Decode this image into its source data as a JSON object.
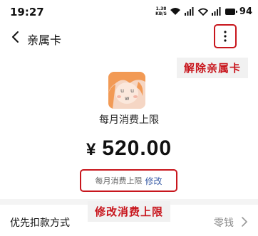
{
  "status_bar": {
    "time": "19:27",
    "net_speed_value": "1.38",
    "net_speed_unit": "KB/S",
    "battery": "94"
  },
  "nav": {
    "title": "亲属卡"
  },
  "annotations": {
    "unbind_label": "解除亲属卡",
    "modify_label": "修改消费上限",
    "highlight_color": "#c8161d"
  },
  "card": {
    "limit_title": "每月消费上限",
    "currency": "¥",
    "amount": "520.00",
    "limit_label": "每月消费上限",
    "modify_link": "修改"
  },
  "payment_row": {
    "label": "优先扣款方式",
    "value": "零钱"
  }
}
